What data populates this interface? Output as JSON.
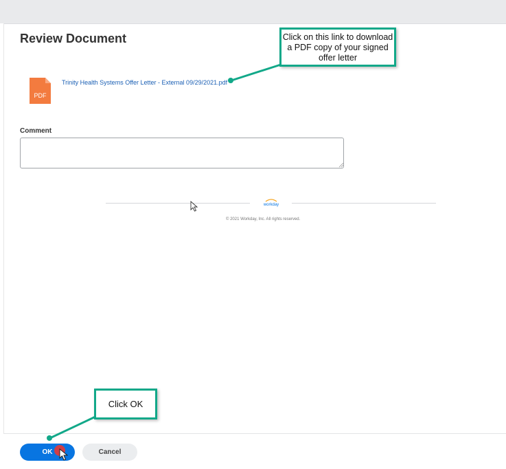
{
  "page": {
    "title": "Review Document"
  },
  "document": {
    "icon_label": "PDF",
    "file_link": "Trinity Health Systems Offer Letter - External 09/29/2021.pdf"
  },
  "comment": {
    "label": "Comment",
    "value": ""
  },
  "footer": {
    "logo_text": "workday",
    "copyright": "© 2021 Workday, Inc. All rights reserved."
  },
  "actions": {
    "ok_label": "OK",
    "cancel_label": "Cancel"
  },
  "annotations": {
    "download_callout": "Click on this link to download a PDF copy of your signed offer letter",
    "ok_callout": "Click OK"
  },
  "colors": {
    "accent": "#0875e1",
    "pdf_icon": "#f37b3f",
    "callout_border": "#12a889",
    "link": "#1a5fb4",
    "click_indicator": "#e53935"
  },
  "icons": {
    "file": "pdf-file-icon",
    "cursor": "mouse-pointer-icon"
  }
}
